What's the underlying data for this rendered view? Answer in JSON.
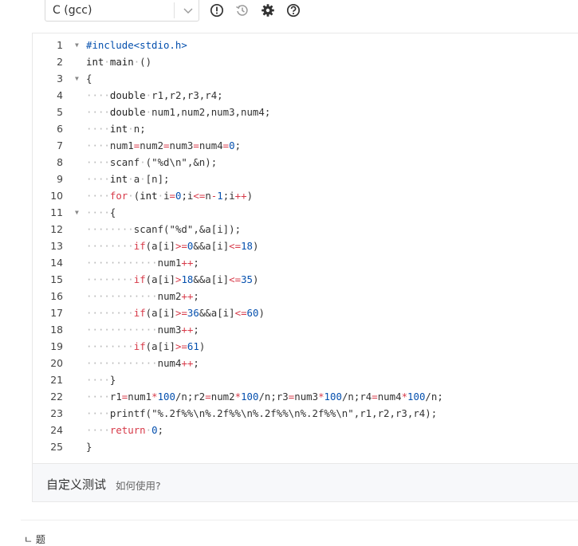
{
  "toolbar": {
    "language": "C (gcc)",
    "icons": [
      "info-icon",
      "history-icon",
      "gear-icon",
      "help-icon"
    ]
  },
  "editor": {
    "line_numbers": [
      "1",
      "2",
      "3",
      "4",
      "5",
      "6",
      "7",
      "8",
      "9",
      "10",
      "11",
      "12",
      "13",
      "14",
      "15",
      "16",
      "17",
      "18",
      "19",
      "20",
      "21",
      "22",
      "23",
      "24",
      "25"
    ],
    "fold_markers": [
      "1",
      "3",
      "11"
    ],
    "lines": [
      "#include<stdio.h>",
      "int main ()",
      "{",
      "    double r1,r2,r3,r4;",
      "    double num1,num2,num3,num4;",
      "    int n;",
      "    num1=num2=num3=num4=0;",
      "    scanf (\"%d\\n\",&n);",
      "    int a [n];",
      "    for (int i=0;i<=n-1;i++)",
      "    {",
      "        scanf(\"%d\",&a[i]);",
      "        if(a[i]>=0&&a[i]<=18)",
      "            num1++;",
      "        if(a[i]>18&&a[i]<=35)",
      "            num2++;",
      "        if(a[i]>=36&&a[i]<=60)",
      "            num3++;",
      "        if(a[i]>=61)",
      "            num4++;",
      "    }",
      "    r1=num1*100/n;r2=num2*100/n;r3=num3*100/n;r4=num4*100/n;",
      "    printf(\"%.2f%%\\n%.2f%%\\n%.2f%%\\n%.2f%%\\n\",r1,r2,r3,r4);",
      "    return 0;",
      "}"
    ]
  },
  "footer": {
    "title": "自定义测试",
    "help_link": "如何使用?"
  },
  "bottom_fragment": "ㄴ 题"
}
